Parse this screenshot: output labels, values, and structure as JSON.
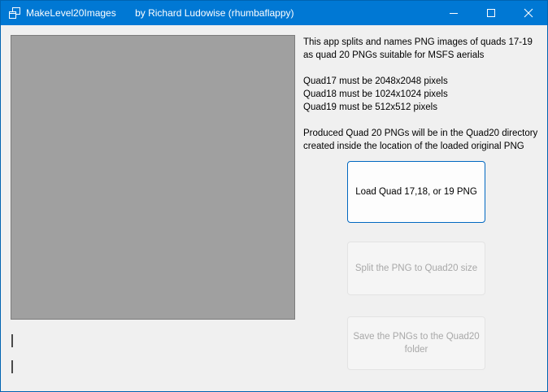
{
  "window": {
    "title": "MakeLevel20Images       by Richard Ludowise (rhumbaflappy)",
    "icon": "app-window-icon",
    "controls": {
      "minimize": "minimize-icon",
      "maximize": "maximize-icon",
      "close": "close-icon"
    }
  },
  "info": {
    "intro_line1": "This app splits and names PNG images of quads 17-19",
    "intro_line2": "as quad 20 PNGs suitable for MSFS aerials",
    "req_line1": "Quad17 must be 2048x2048 pixels",
    "req_line2": "Quad18 must be 1024x1024 pixels",
    "req_line3": "Quad19 must be 512x512 pixels",
    "output_line1": "Produced Quad 20 PNGs will be in the Quad20 directory",
    "output_line2": "created inside the location of the loaded original PNG"
  },
  "buttons": {
    "load_label": "Load Quad 17,18, or 19 PNG",
    "split_label": "Split the PNG to Quad20 size",
    "save_label": "Save the PNGs to the Quad20 folder"
  },
  "colors": {
    "titlebar": "#0078d4",
    "window_bg": "#f0f0f0",
    "image_placeholder": "#a0a0a0",
    "focus_border": "#0067c0",
    "disabled_text": "#a8a8a8"
  }
}
